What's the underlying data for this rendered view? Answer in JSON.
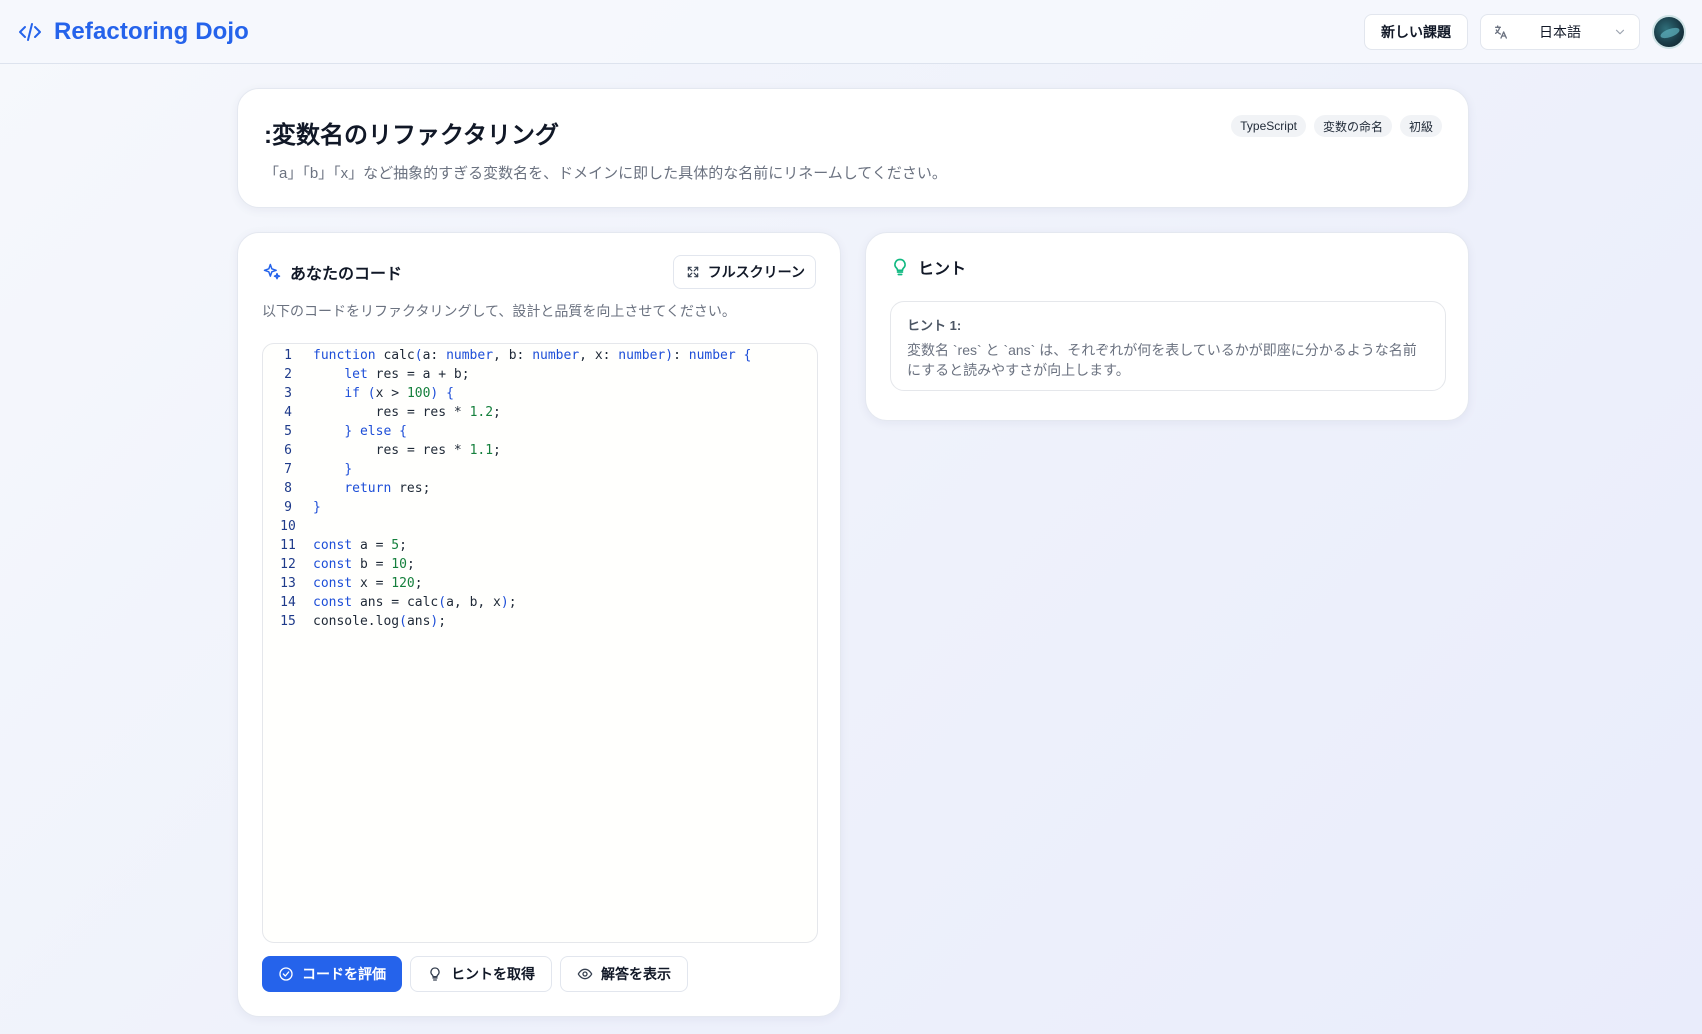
{
  "header": {
    "app_title": "Refactoring Dojo",
    "new_task_label": "新しい課題",
    "language": "日本語"
  },
  "task": {
    "title": ":変数名のリファクタリング",
    "description": "「a」「b」「x」など抽象的すぎる変数名を、ドメインに即した具体的な名前にリネームしてください。",
    "tags": [
      "TypeScript",
      "変数の命名",
      "初級"
    ]
  },
  "code_panel": {
    "title": "あなたのコード",
    "fullscreen_label": "フルスクリーン",
    "subtitle": "以下のコードをリファクタリングして、設計と品質を向上させてください。",
    "lines": [
      "function calc(a: number, b: number, x: number): number {",
      "    let res = a + b;",
      "    if (x > 100) {",
      "        res = res * 1.2;",
      "    } else {",
      "        res = res * 1.1;",
      "    }",
      "    return res;",
      "}",
      "",
      "const a = 5;",
      "const b = 10;",
      "const x = 120;",
      "const ans = calc(a, b, x);",
      "console.log(ans);"
    ],
    "evaluate_label": "コードを評価",
    "get_hint_label": "ヒントを取得",
    "show_answer_label": "解答を表示"
  },
  "hint_panel": {
    "title": "ヒント",
    "hint_label": "ヒント 1:",
    "hint_text": "変数名 `res` と `ans` は、それぞれが何を表しているかが即座に分かるような名前にすると読みやすさが向上します。"
  },
  "colors": {
    "accent": "#2563eb",
    "hint_icon": "#10b981"
  }
}
